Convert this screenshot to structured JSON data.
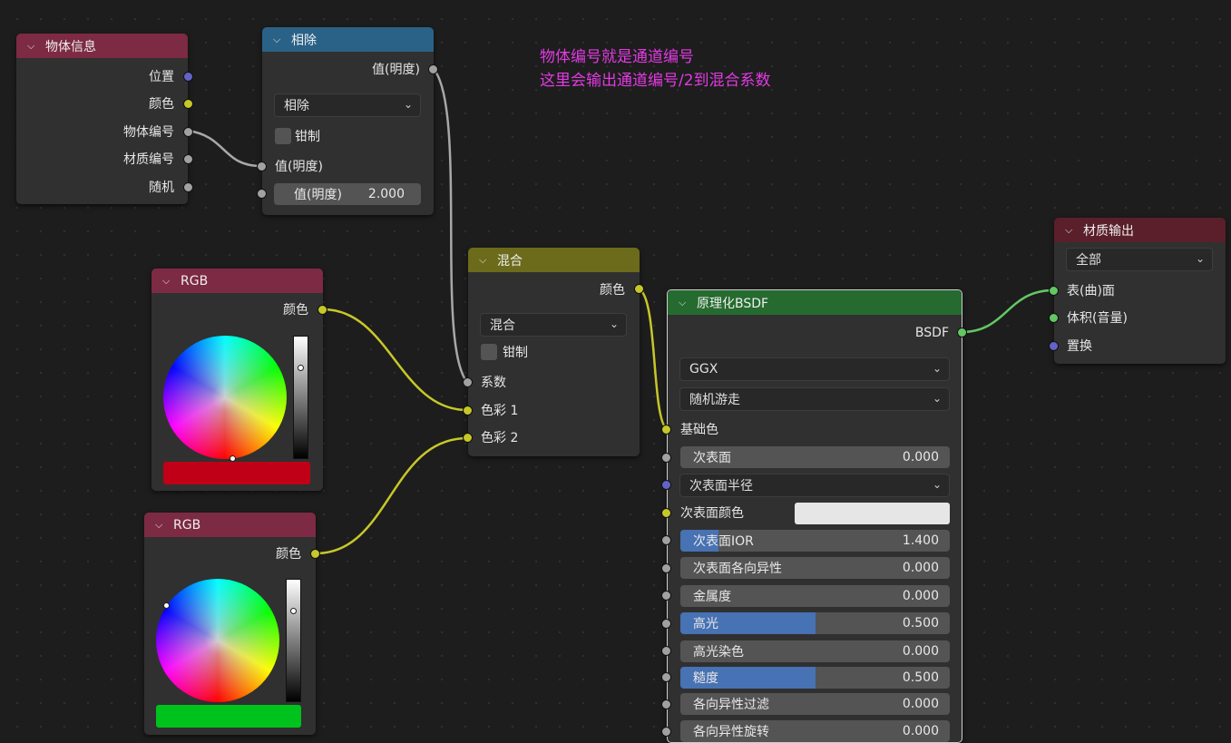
{
  "annotation": {
    "line1": "物体编号就是通道编号",
    "line2": "这里会输出通道编号/2到混合系数"
  },
  "object_info": {
    "title": "物体信息",
    "header_color": "#7d2a44",
    "outputs": [
      "位置",
      "颜色",
      "物体编号",
      "材质编号",
      "随机"
    ]
  },
  "divide": {
    "title": "相除",
    "header_color": "#2a6287",
    "output": "值(明度)",
    "operation": "相除",
    "clamp_label": "钳制",
    "input1": "值(明度)",
    "input2_label": "值(明度)",
    "input2_value": "2.000"
  },
  "rgb1": {
    "title": "RGB",
    "header_color": "#7d2a44",
    "output": "颜色",
    "swatch_color": "#c00016"
  },
  "rgb2": {
    "title": "RGB",
    "header_color": "#7d2a44",
    "output": "颜色",
    "swatch_color": "#00c21c"
  },
  "mix": {
    "title": "混合",
    "header_color": "#6b6b1b",
    "output": "颜色",
    "blend": "混合",
    "clamp_label": "钳制",
    "inputs": [
      "系数",
      "色彩 1",
      "色彩 2"
    ]
  },
  "bsdf": {
    "title": "原理化BSDF",
    "header_color": "#256b2f",
    "output": "BSDF",
    "distribution": "GGX",
    "subsurface_method": "随机游走",
    "base_color_label": "基础色",
    "subsurface_radius": "次表面半径",
    "subsurface_color": "次表面颜色",
    "subsurface_color_value": "#e6e6e6",
    "fields": [
      {
        "label": "次表面",
        "value": "0.000",
        "fill": 0
      },
      {
        "label": "次表面IOR",
        "value": "1.400",
        "fill": 0.14
      },
      {
        "label": "次表面各向异性",
        "value": "0.000",
        "fill": 0
      },
      {
        "label": "金属度",
        "value": "0.000",
        "fill": 0
      },
      {
        "label": "高光",
        "value": "0.500",
        "fill": 0.5
      },
      {
        "label": "高光染色",
        "value": "0.000",
        "fill": 0
      },
      {
        "label": "糙度",
        "value": "0.500",
        "fill": 0.5
      },
      {
        "label": "各向异性过滤",
        "value": "0.000",
        "fill": 0
      },
      {
        "label": "各向异性旋转",
        "value": "0.000",
        "fill": 0
      }
    ]
  },
  "output": {
    "title": "材质输出",
    "header_color": "#5a1f2a",
    "target": "全部",
    "inputs": [
      "表(曲)面",
      "体积(音量)",
      "置换"
    ]
  }
}
